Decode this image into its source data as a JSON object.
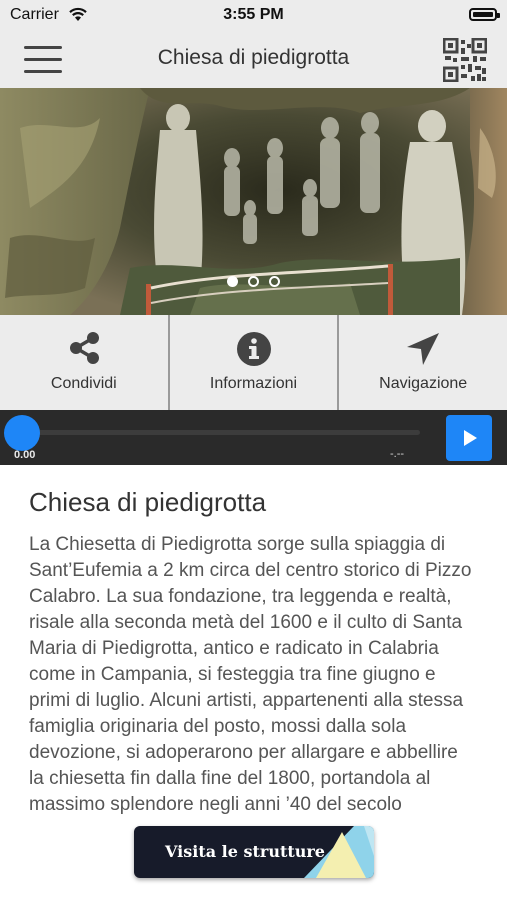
{
  "status_bar": {
    "carrier": "Carrier",
    "time": "3:55 PM"
  },
  "header": {
    "title": "Chiesa di piedigrotta",
    "menu_icon": "hamburger-menu-icon",
    "qr_icon": "qr-code-icon"
  },
  "gallery": {
    "slide_count": 3,
    "active_slide": 1
  },
  "actions": [
    {
      "label": "Condividi",
      "icon": "share-icon"
    },
    {
      "label": "Informazioni",
      "icon": "info-icon"
    },
    {
      "label": "Navigazione",
      "icon": "navigation-arrow-icon"
    }
  ],
  "player": {
    "current_time": "0.00",
    "duration": "-.--",
    "progress": 0,
    "accent_color": "#1e86f7"
  },
  "article": {
    "title": "Chiesa di piedigrotta",
    "body": "La Chiesetta di Piedigrotta sorge sulla spiaggia di Sant’Eufemia a 2 km circa del centro storico di Pizzo Calabro. La sua fondazione, tra leggenda e realtà, risale alla seconda metà del 1600 e il culto di Santa Maria di Piedigrotta, antico e radicato in Calabria come in Campania, si festeggia tra fine giugno e primi di luglio. Alcuni artisti, appartenenti alla stessa famiglia originaria del posto, mossi dalla sola devozione, si adoperarono per allargare e abbellire la chiesetta fin dalla fine del 1800, portandola al massimo splendore negli anni ’40 del secolo"
  },
  "cta": {
    "label": "Visita le strutture",
    "background": "#171b2a"
  }
}
